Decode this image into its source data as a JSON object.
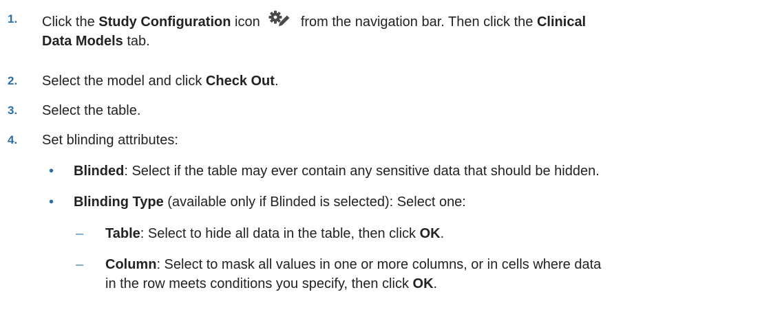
{
  "colors": {
    "number": "#2c6ea5",
    "bullet": "#2c6ea5",
    "text": "#222222",
    "icon": "#4a4a4a"
  },
  "steps": [
    {
      "number": "1.",
      "line1_pre": "Click the ",
      "line1_b1": "Study Configuration",
      "line1_mid": " icon ",
      "icon": "gear-pencil-icon",
      "line1_post": " from the navigation bar. Then click the ",
      "line1_b2": "Clinical",
      "line2_b": "Data Models",
      "line2_post": " tab."
    },
    {
      "number": "2.",
      "pre": "Select the model and click ",
      "bold": "Check Out",
      "post": "."
    },
    {
      "number": "3.",
      "text": "Select the table."
    },
    {
      "number": "4.",
      "text": "Set blinding attributes:",
      "bullets": [
        {
          "symbol": "•",
          "bold": "Blinded",
          "text": ": Select if the table may ever contain any sensitive data that should be hidden."
        },
        {
          "symbol": "•",
          "bold": "Blinding Type",
          "text": " (available only if Blinded is selected): Select one:",
          "subitems": [
            {
              "symbol": "–",
              "bold": "Table",
              "text": ": Select to hide all data in the table, then click ",
              "bold2": "OK",
              "end": "."
            },
            {
              "symbol": "–",
              "bold": "Column",
              "text": ": Select to mask all values in one or more columns, or in cells where data",
              "line2": "in the row meets conditions you specify, then click ",
              "bold2": "OK",
              "end": "."
            }
          ]
        }
      ]
    }
  ]
}
